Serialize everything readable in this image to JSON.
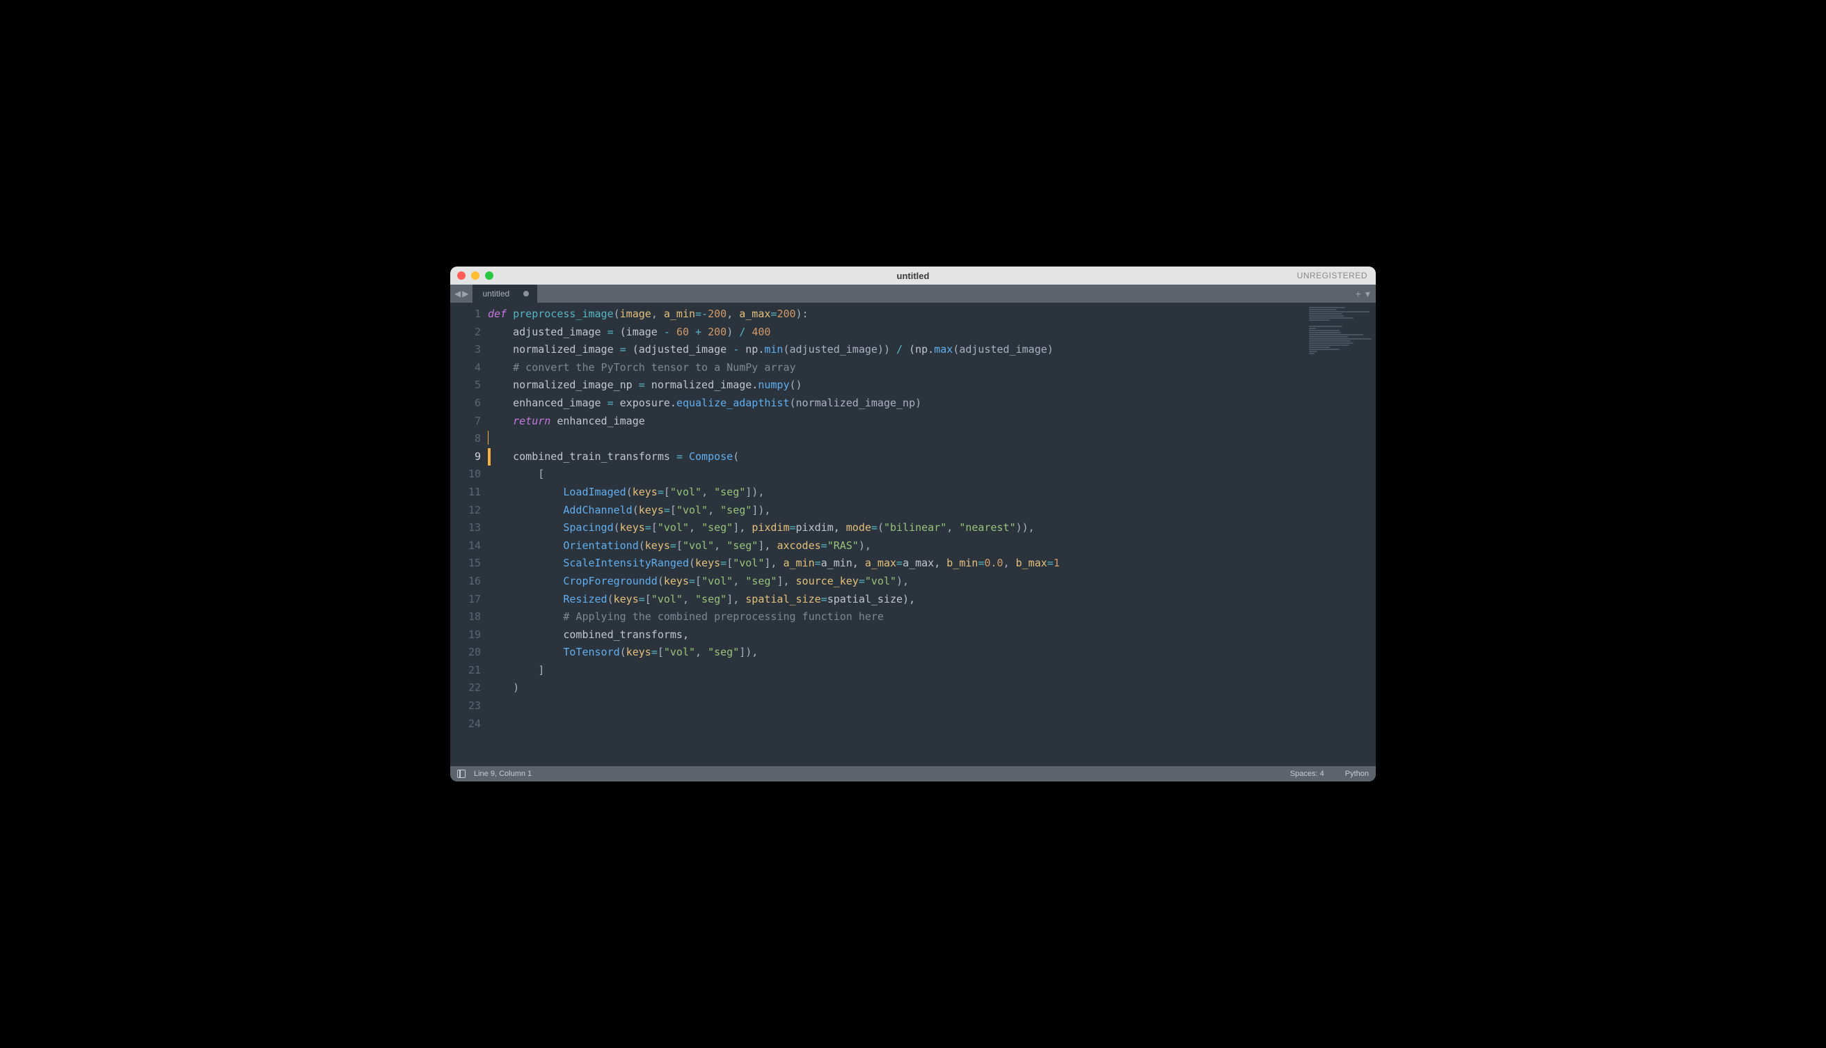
{
  "window": {
    "title": "untitled",
    "registered_label": "UNREGISTERED"
  },
  "tab": {
    "name": "untitled"
  },
  "statusbar": {
    "position": "Line 9, Column 1",
    "spaces": "Spaces: 4",
    "syntax": "Python"
  },
  "gutter": {
    "active_line": 9,
    "lines": [
      "1",
      "2",
      "3",
      "4",
      "5",
      "6",
      "7",
      "8",
      "9",
      "10",
      "11",
      "12",
      "13",
      "14",
      "15",
      "16",
      "17",
      "18",
      "19",
      "20",
      "21",
      "22",
      "23",
      "24"
    ]
  },
  "code": {
    "lines": [
      [
        {
          "t": "def",
          "c": "kw"
        },
        {
          "t": " ",
          "c": ""
        },
        {
          "t": "preprocess_image",
          "c": "fn"
        },
        {
          "t": "(",
          "c": "pun"
        },
        {
          "t": "image",
          "c": "param"
        },
        {
          "t": ", ",
          "c": "pun"
        },
        {
          "t": "a_min",
          "c": "param"
        },
        {
          "t": "=-",
          "c": "op"
        },
        {
          "t": "200",
          "c": "num"
        },
        {
          "t": ", ",
          "c": "pun"
        },
        {
          "t": "a_max",
          "c": "param"
        },
        {
          "t": "=",
          "c": "op"
        },
        {
          "t": "200",
          "c": "num"
        },
        {
          "t": "):",
          "c": "pun"
        }
      ],
      [
        {
          "t": "    adjusted_image ",
          "c": ""
        },
        {
          "t": "=",
          "c": "op"
        },
        {
          "t": " (image ",
          "c": ""
        },
        {
          "t": "-",
          "c": "op"
        },
        {
          "t": " ",
          "c": ""
        },
        {
          "t": "60",
          "c": "num"
        },
        {
          "t": " ",
          "c": ""
        },
        {
          "t": "+",
          "c": "op"
        },
        {
          "t": " ",
          "c": ""
        },
        {
          "t": "200",
          "c": "num"
        },
        {
          "t": ") ",
          "c": "pun"
        },
        {
          "t": "/",
          "c": "op"
        },
        {
          "t": " ",
          "c": ""
        },
        {
          "t": "400",
          "c": "num"
        }
      ],
      [
        {
          "t": "    normalized_image ",
          "c": ""
        },
        {
          "t": "=",
          "c": "op"
        },
        {
          "t": " (adjusted_image ",
          "c": ""
        },
        {
          "t": "-",
          "c": "op"
        },
        {
          "t": " np.",
          "c": ""
        },
        {
          "t": "min",
          "c": "fncall"
        },
        {
          "t": "(adjusted_image)) ",
          "c": "pun"
        },
        {
          "t": "/",
          "c": "op"
        },
        {
          "t": " (np.",
          "c": ""
        },
        {
          "t": "max",
          "c": "fncall"
        },
        {
          "t": "(adjusted_image) ",
          "c": "pun"
        }
      ],
      [
        {
          "t": "    ",
          "c": ""
        },
        {
          "t": "# convert the PyTorch tensor to a NumPy array",
          "c": "cm"
        }
      ],
      [
        {
          "t": "    normalized_image_np ",
          "c": ""
        },
        {
          "t": "=",
          "c": "op"
        },
        {
          "t": " normalized_image.",
          "c": ""
        },
        {
          "t": "numpy",
          "c": "fncall"
        },
        {
          "t": "()",
          "c": "pun"
        }
      ],
      [
        {
          "t": "    enhanced_image ",
          "c": ""
        },
        {
          "t": "=",
          "c": "op"
        },
        {
          "t": " exposure.",
          "c": ""
        },
        {
          "t": "equalize_adapthist",
          "c": "fncall"
        },
        {
          "t": "(normalized_image_np)",
          "c": "pun"
        }
      ],
      [
        {
          "t": "    ",
          "c": ""
        },
        {
          "t": "return",
          "c": "kw"
        },
        {
          "t": " enhanced_image",
          "c": ""
        }
      ],
      [
        {
          "t": "",
          "c": ""
        }
      ],
      [
        {
          "t": "",
          "c": "",
          "cursor": true
        }
      ],
      [
        {
          "t": "    combined_train_transforms ",
          "c": ""
        },
        {
          "t": "=",
          "c": "op"
        },
        {
          "t": " ",
          "c": ""
        },
        {
          "t": "Compose",
          "c": "fncall"
        },
        {
          "t": "(",
          "c": "pun"
        }
      ],
      [
        {
          "t": "        [",
          "c": "pun"
        }
      ],
      [
        {
          "t": "            ",
          "c": ""
        },
        {
          "t": "LoadImaged",
          "c": "fncall"
        },
        {
          "t": "(",
          "c": "pun"
        },
        {
          "t": "keys",
          "c": "param"
        },
        {
          "t": "=",
          "c": "op"
        },
        {
          "t": "[",
          "c": "pun"
        },
        {
          "t": "\"vol\"",
          "c": "str"
        },
        {
          "t": ", ",
          "c": "pun"
        },
        {
          "t": "\"seg\"",
          "c": "str"
        },
        {
          "t": "]),",
          "c": "pun"
        }
      ],
      [
        {
          "t": "            ",
          "c": ""
        },
        {
          "t": "AddChanneld",
          "c": "fncall"
        },
        {
          "t": "(",
          "c": "pun"
        },
        {
          "t": "keys",
          "c": "param"
        },
        {
          "t": "=",
          "c": "op"
        },
        {
          "t": "[",
          "c": "pun"
        },
        {
          "t": "\"vol\"",
          "c": "str"
        },
        {
          "t": ", ",
          "c": "pun"
        },
        {
          "t": "\"seg\"",
          "c": "str"
        },
        {
          "t": "]),",
          "c": "pun"
        }
      ],
      [
        {
          "t": "            ",
          "c": ""
        },
        {
          "t": "Spacingd",
          "c": "fncall"
        },
        {
          "t": "(",
          "c": "pun"
        },
        {
          "t": "keys",
          "c": "param"
        },
        {
          "t": "=",
          "c": "op"
        },
        {
          "t": "[",
          "c": "pun"
        },
        {
          "t": "\"vol\"",
          "c": "str"
        },
        {
          "t": ", ",
          "c": "pun"
        },
        {
          "t": "\"seg\"",
          "c": "str"
        },
        {
          "t": "], ",
          "c": "pun"
        },
        {
          "t": "pixdim",
          "c": "param"
        },
        {
          "t": "=",
          "c": "op"
        },
        {
          "t": "pixdim, ",
          "c": ""
        },
        {
          "t": "mode",
          "c": "param"
        },
        {
          "t": "=",
          "c": "op"
        },
        {
          "t": "(",
          "c": "pun"
        },
        {
          "t": "\"bilinear\"",
          "c": "str"
        },
        {
          "t": ", ",
          "c": "pun"
        },
        {
          "t": "\"nearest\"",
          "c": "str"
        },
        {
          "t": ")),",
          "c": "pun"
        }
      ],
      [
        {
          "t": "            ",
          "c": ""
        },
        {
          "t": "Orientationd",
          "c": "fncall"
        },
        {
          "t": "(",
          "c": "pun"
        },
        {
          "t": "keys",
          "c": "param"
        },
        {
          "t": "=",
          "c": "op"
        },
        {
          "t": "[",
          "c": "pun"
        },
        {
          "t": "\"vol\"",
          "c": "str"
        },
        {
          "t": ", ",
          "c": "pun"
        },
        {
          "t": "\"seg\"",
          "c": "str"
        },
        {
          "t": "], ",
          "c": "pun"
        },
        {
          "t": "axcodes",
          "c": "param"
        },
        {
          "t": "=",
          "c": "op"
        },
        {
          "t": "\"RAS\"",
          "c": "str"
        },
        {
          "t": "),",
          "c": "pun"
        }
      ],
      [
        {
          "t": "            ",
          "c": ""
        },
        {
          "t": "ScaleIntensityRanged",
          "c": "fncall"
        },
        {
          "t": "(",
          "c": "pun"
        },
        {
          "t": "keys",
          "c": "param"
        },
        {
          "t": "=",
          "c": "op"
        },
        {
          "t": "[",
          "c": "pun"
        },
        {
          "t": "\"vol\"",
          "c": "str"
        },
        {
          "t": "], ",
          "c": "pun"
        },
        {
          "t": "a_min",
          "c": "param"
        },
        {
          "t": "=",
          "c": "op"
        },
        {
          "t": "a_min, ",
          "c": ""
        },
        {
          "t": "a_max",
          "c": "param"
        },
        {
          "t": "=",
          "c": "op"
        },
        {
          "t": "a_max, ",
          "c": ""
        },
        {
          "t": "b_min",
          "c": "param"
        },
        {
          "t": "=",
          "c": "op"
        },
        {
          "t": "0.0",
          "c": "num"
        },
        {
          "t": ", ",
          "c": "pun"
        },
        {
          "t": "b_max",
          "c": "param"
        },
        {
          "t": "=",
          "c": "op"
        },
        {
          "t": "1",
          "c": "num"
        }
      ],
      [
        {
          "t": "            ",
          "c": ""
        },
        {
          "t": "CropForegroundd",
          "c": "fncall"
        },
        {
          "t": "(",
          "c": "pun"
        },
        {
          "t": "keys",
          "c": "param"
        },
        {
          "t": "=",
          "c": "op"
        },
        {
          "t": "[",
          "c": "pun"
        },
        {
          "t": "\"vol\"",
          "c": "str"
        },
        {
          "t": ", ",
          "c": "pun"
        },
        {
          "t": "\"seg\"",
          "c": "str"
        },
        {
          "t": "], ",
          "c": "pun"
        },
        {
          "t": "source_key",
          "c": "param"
        },
        {
          "t": "=",
          "c": "op"
        },
        {
          "t": "\"vol\"",
          "c": "str"
        },
        {
          "t": "),",
          "c": "pun"
        }
      ],
      [
        {
          "t": "            ",
          "c": ""
        },
        {
          "t": "Resized",
          "c": "fncall"
        },
        {
          "t": "(",
          "c": "pun"
        },
        {
          "t": "keys",
          "c": "param"
        },
        {
          "t": "=",
          "c": "op"
        },
        {
          "t": "[",
          "c": "pun"
        },
        {
          "t": "\"vol\"",
          "c": "str"
        },
        {
          "t": ", ",
          "c": "pun"
        },
        {
          "t": "\"seg\"",
          "c": "str"
        },
        {
          "t": "], ",
          "c": "pun"
        },
        {
          "t": "spatial_size",
          "c": "param"
        },
        {
          "t": "=",
          "c": "op"
        },
        {
          "t": "spatial_size),",
          "c": ""
        }
      ],
      [
        {
          "t": "            ",
          "c": ""
        },
        {
          "t": "# Applying the combined preprocessing function here",
          "c": "cm"
        }
      ],
      [
        {
          "t": "            combined_transforms,",
          "c": ""
        }
      ],
      [
        {
          "t": "            ",
          "c": ""
        },
        {
          "t": "ToTensord",
          "c": "fncall"
        },
        {
          "t": "(",
          "c": "pun"
        },
        {
          "t": "keys",
          "c": "param"
        },
        {
          "t": "=",
          "c": "op"
        },
        {
          "t": "[",
          "c": "pun"
        },
        {
          "t": "\"vol\"",
          "c": "str"
        },
        {
          "t": ", ",
          "c": "pun"
        },
        {
          "t": "\"seg\"",
          "c": "str"
        },
        {
          "t": "]),",
          "c": "pun"
        }
      ],
      [
        {
          "t": "        ]",
          "c": "pun"
        }
      ],
      [
        {
          "t": "    )",
          "c": "pun"
        }
      ],
      [
        {
          "t": "",
          "c": ""
        }
      ]
    ]
  },
  "minimap": {
    "widths": [
      52,
      40,
      88,
      48,
      50,
      64,
      30,
      0,
      0,
      48,
      10,
      44,
      46,
      78,
      56,
      90,
      60,
      64,
      58,
      30,
      44,
      12,
      8,
      0
    ]
  }
}
